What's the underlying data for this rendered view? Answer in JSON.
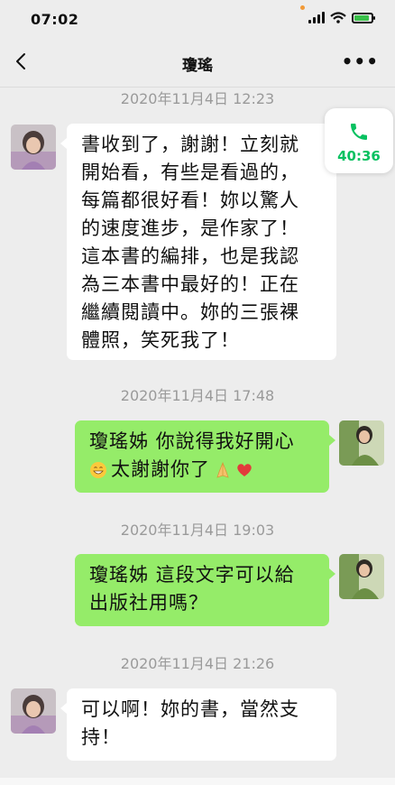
{
  "status_bar": {
    "time": "07:02"
  },
  "nav": {
    "title": "瓊瑤",
    "more_label": "•••"
  },
  "call": {
    "duration": "40:36"
  },
  "messages": [
    {
      "timestamp": "2020年11月4日 12:23",
      "side": "left",
      "lines": [
        "書收到了，謝謝！立刻就",
        "開始看，有些是看過的，",
        "每篇都很好看！妳以驚人",
        "的速度進步，是作家了！",
        "這本書的編排，也是我認",
        "為三本書中最好的！正在",
        "繼續閱讀中。妳的三張裸",
        "體照，笑死我了！"
      ]
    },
    {
      "timestamp": "2020年11月4日 17:48",
      "side": "right",
      "lines": [
        "瓊瑤姊 你說得我好開心",
        "太謝謝你了"
      ]
    },
    {
      "timestamp": "2020年11月4日 19:03",
      "side": "right",
      "lines": [
        "瓊瑤姊 這段文字可以給",
        "出版社用嗎？"
      ]
    },
    {
      "timestamp": "2020年11月4日 21:26",
      "side": "left",
      "lines": [
        "可以啊！妳的書，當然支",
        "持！"
      ]
    }
  ],
  "colors": {
    "my_bubble": "#95ec69",
    "their_bubble": "#ffffff",
    "accent": "#07c160"
  }
}
